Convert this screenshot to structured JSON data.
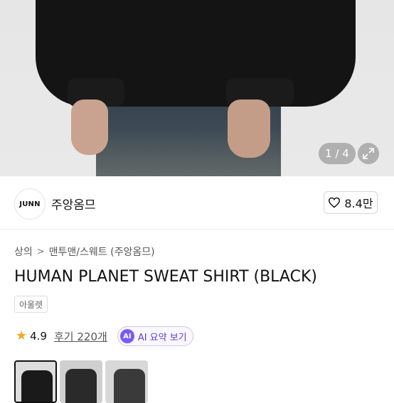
{
  "gallery": {
    "counter": "1 / 4",
    "expand_icon": "expand-icon"
  },
  "brand": {
    "logo_text": "JUNN",
    "name": "주앙옴므",
    "likes": "8.4만",
    "like_icon": "heart-icon"
  },
  "breadcrumb": {
    "items": [
      "상의",
      "맨투맨/스웨트 (주앙옴므)"
    ],
    "separator": ">"
  },
  "product": {
    "title": "HUMAN PLANET SWEAT SHIRT (BLACK)",
    "tag": "아울렛",
    "rating": "4.9",
    "reviews": "후기 220개",
    "ai_badge": "AI",
    "ai_summary": "AI 요약 보기"
  },
  "colors": {
    "star": "#f5a623",
    "ai_accent": "#7a5af8"
  }
}
